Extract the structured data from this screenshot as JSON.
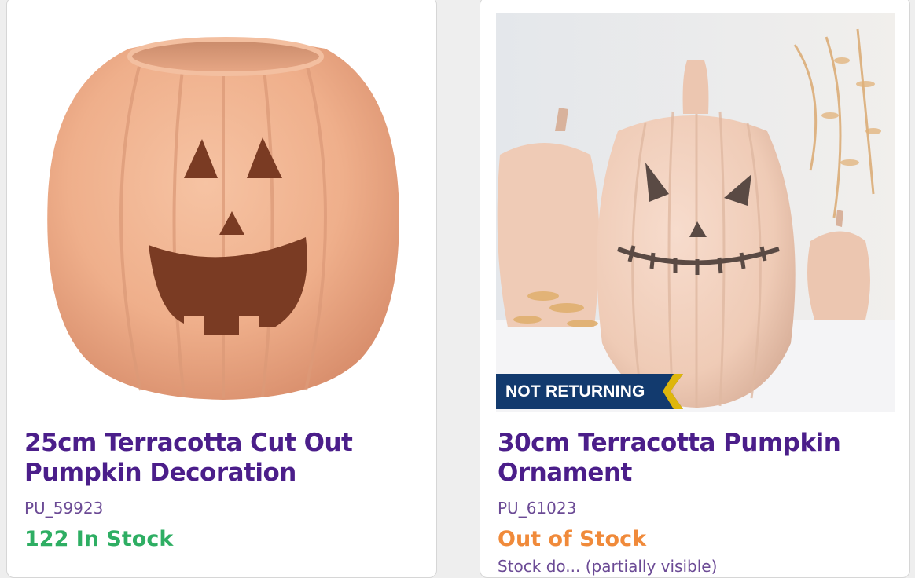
{
  "products": [
    {
      "title": "25cm Terracotta Cut Out Pumpkin Decoration",
      "sku": "PU_59923",
      "stock": "122 In Stock",
      "stock_color": "#2eae63"
    },
    {
      "title": "30cm Terracotta Pumpkin Ornament",
      "sku": "PU_61023",
      "stock": "Out of Stock",
      "stock_color": "#f08a3a",
      "badge": "NOT RETURNING",
      "note": "Stock do... (partially visible)"
    }
  ],
  "colors": {
    "title": "#4b1e8a",
    "badge_bg": "#123a6e",
    "badge_accent": "#f5c400"
  }
}
